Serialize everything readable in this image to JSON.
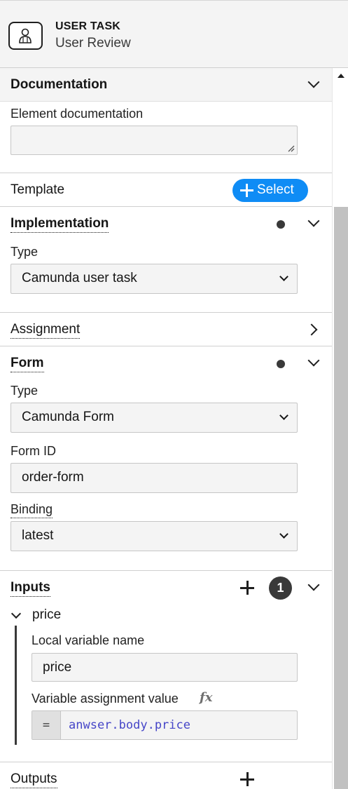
{
  "header": {
    "icon": "user-task-icon",
    "element_type": "USER TASK",
    "element_name": "User Review"
  },
  "documentation": {
    "title": "Documentation",
    "label": "Element documentation",
    "value": ""
  },
  "template": {
    "title": "Template",
    "select_label": "Select"
  },
  "implementation": {
    "title": "Implementation",
    "type_label": "Type",
    "type_value": "Camunda user task"
  },
  "assignment": {
    "title": "Assignment"
  },
  "form": {
    "title": "Form",
    "type_label": "Type",
    "type_value": "Camunda Form",
    "form_id_label": "Form ID",
    "form_id_value": "order-form",
    "binding_label": "Binding",
    "binding_value": "latest"
  },
  "inputs": {
    "title": "Inputs",
    "count": "1",
    "items": [
      {
        "name": "price",
        "local_label": "Local variable name",
        "local_value": "price",
        "assign_label": "Variable assignment value",
        "fx_symbol": "fx",
        "eq_symbol": "=",
        "assign_value": "anwser.body.price"
      }
    ]
  },
  "outputs": {
    "title": "Outputs"
  },
  "colors": {
    "accent": "#0f8cf5",
    "feel_code": "#4646c8",
    "badge": "#393939"
  }
}
